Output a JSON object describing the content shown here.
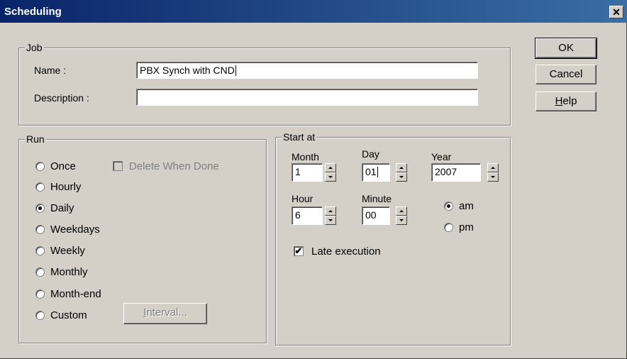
{
  "window": {
    "title": "Scheduling",
    "close_glyph": "✕"
  },
  "job": {
    "legend": "Job",
    "name_label": "Name :",
    "name_value": "PBX Synch with CND",
    "description_label": "Description :",
    "description_value": ""
  },
  "buttons": {
    "ok": "OK",
    "cancel": "Cancel",
    "help_mnemonic": "H",
    "help_rest": "elp"
  },
  "run": {
    "legend": "Run",
    "options": [
      {
        "label": "Once",
        "selected": false
      },
      {
        "label": "Hourly",
        "selected": false
      },
      {
        "label": "Daily",
        "selected": true
      },
      {
        "label": "Weekdays",
        "selected": false
      },
      {
        "label": "Weekly",
        "selected": false
      },
      {
        "label": "Monthly",
        "selected": false
      },
      {
        "label": "Month-end",
        "selected": false
      },
      {
        "label": "Custom",
        "selected": false
      }
    ],
    "delete_when_done_label": "Delete When Done",
    "delete_when_done_checked": false,
    "interval_mnemonic": "I",
    "interval_rest": "nterval..."
  },
  "start_at": {
    "legend": "Start at",
    "month_label": "Month",
    "month_value": "1",
    "day_label": "Day",
    "day_value": "01",
    "year_label": "Year",
    "year_value": "2007",
    "hour_label": "Hour",
    "hour_value": "6",
    "minute_label": "Minute",
    "minute_value": "00",
    "am_label": "am",
    "am_selected": true,
    "pm_label": "pm",
    "pm_selected": false,
    "late_execution_label": "Late execution",
    "late_execution_checked": true,
    "check_glyph": "✔"
  }
}
